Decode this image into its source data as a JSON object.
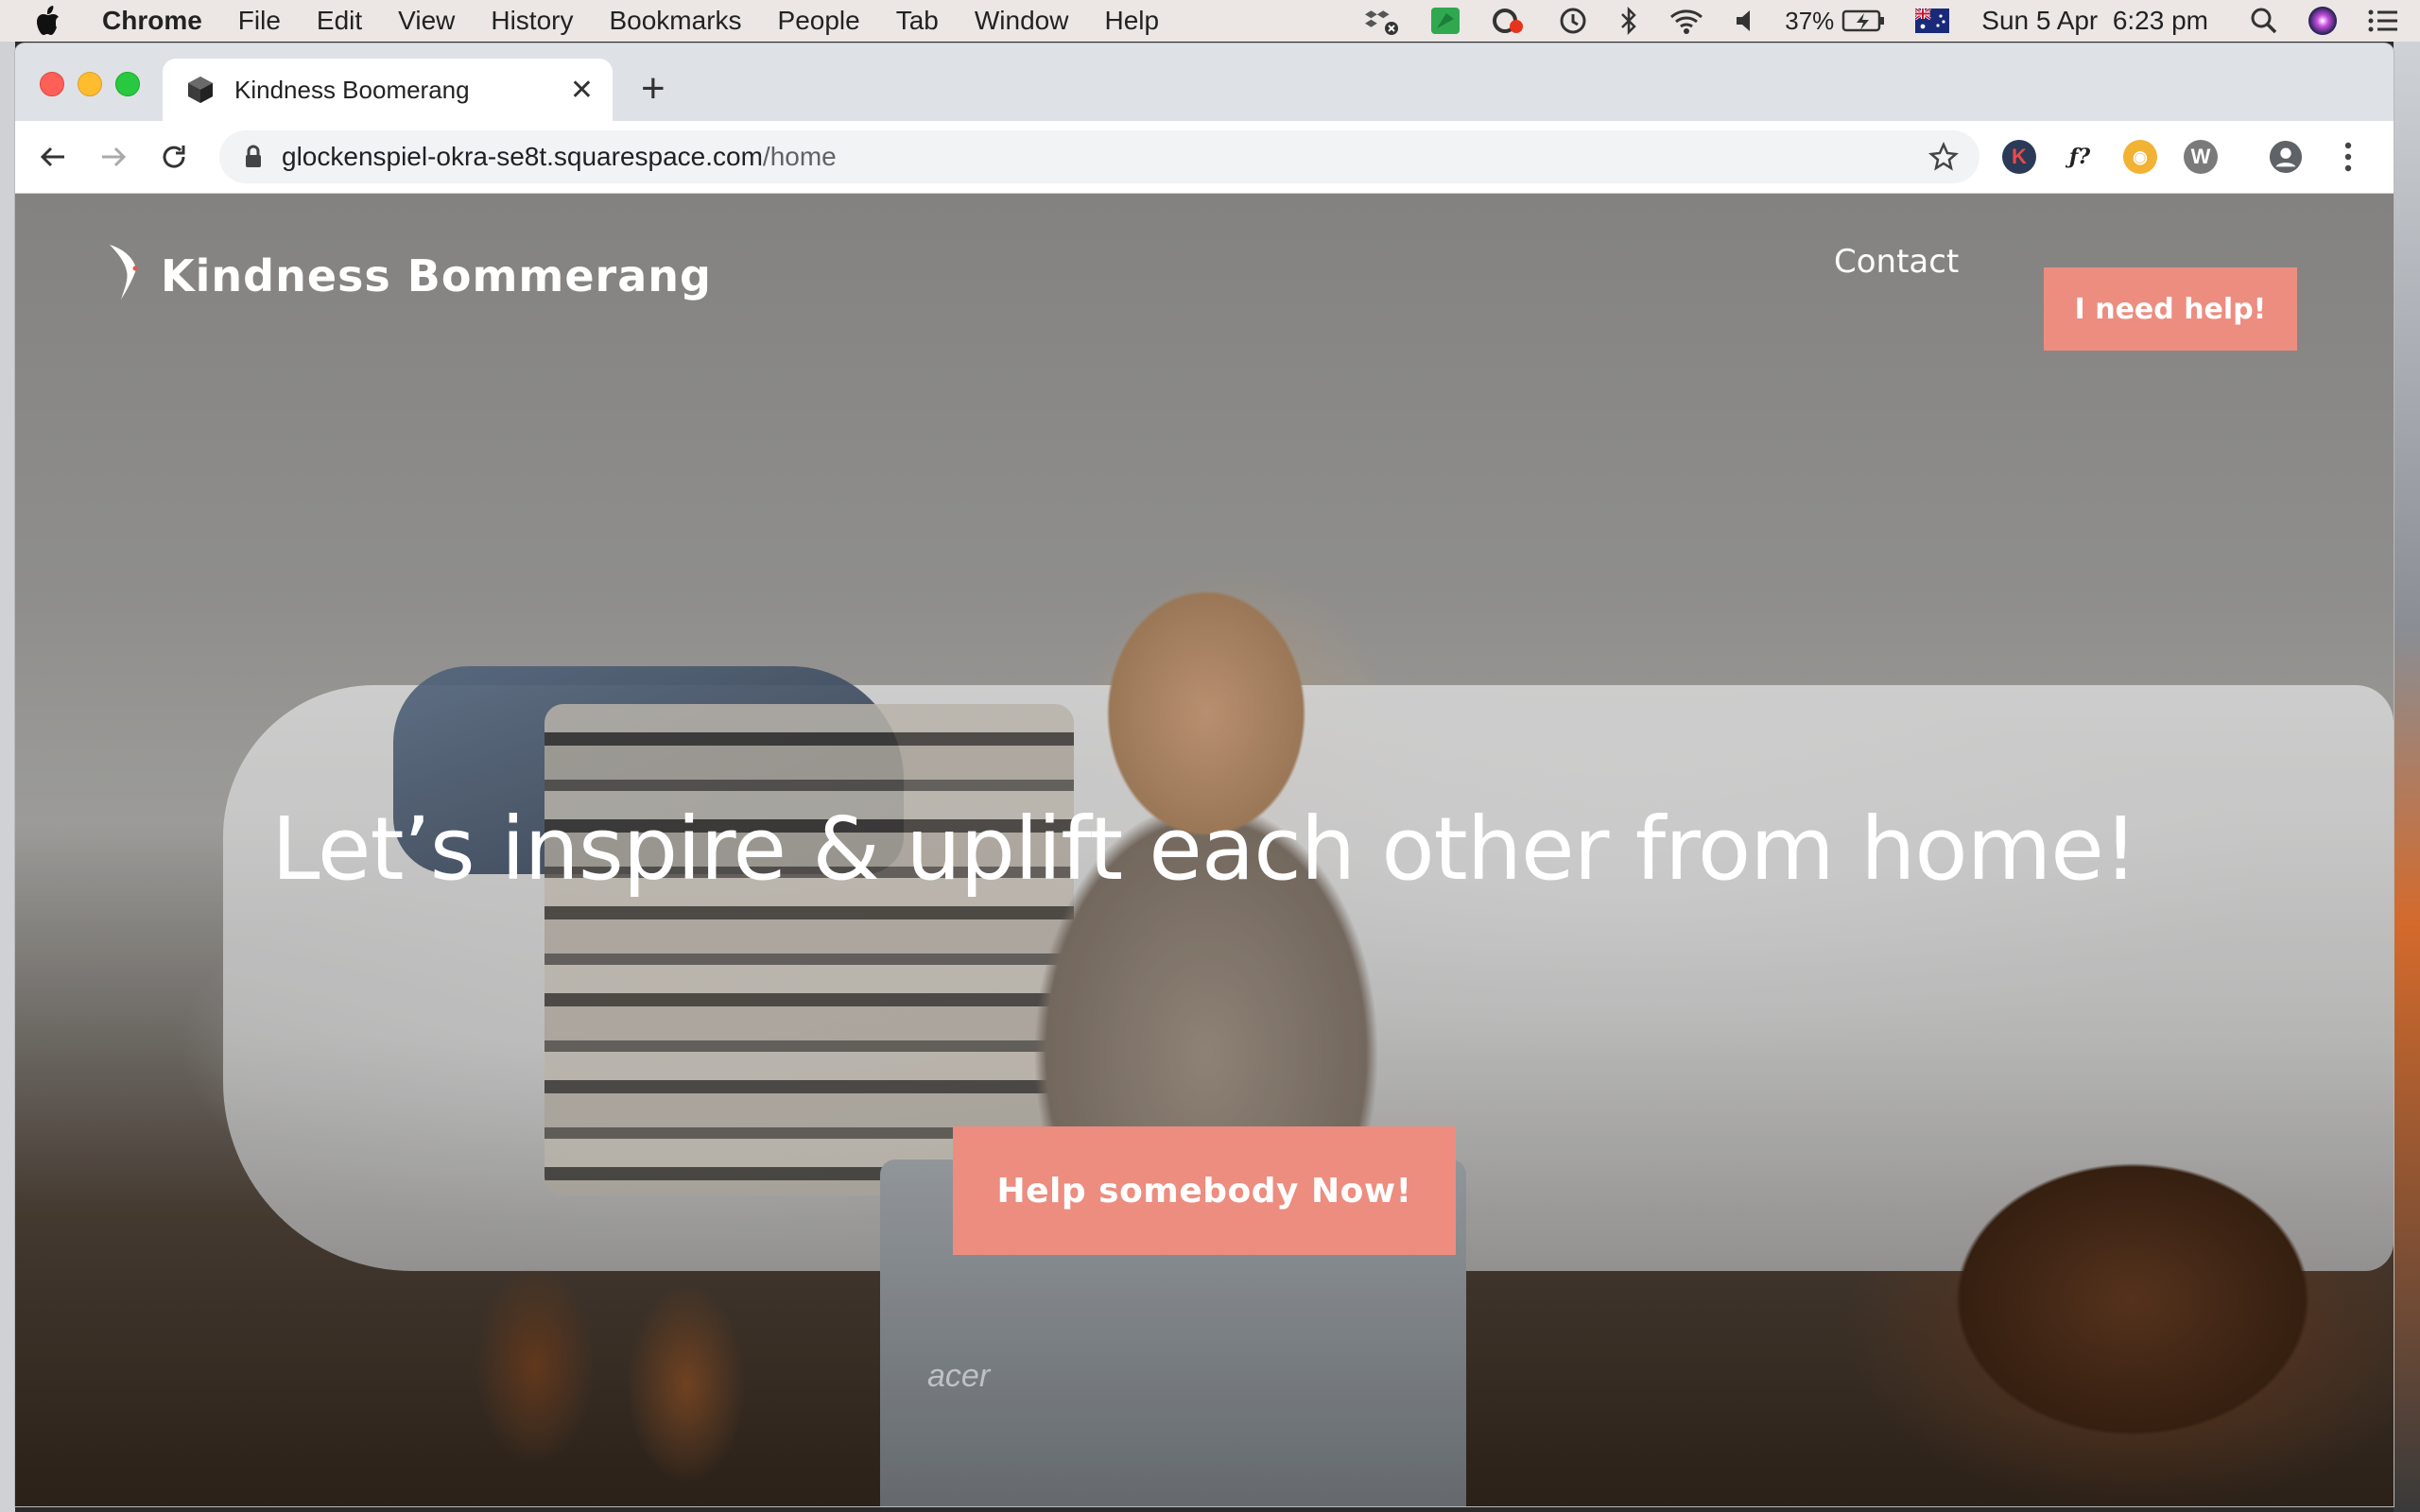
{
  "menubar": {
    "app_name": "Chrome",
    "items": [
      "File",
      "Edit",
      "View",
      "History",
      "Bookmarks",
      "People",
      "Tab",
      "Window",
      "Help"
    ],
    "battery": "37%",
    "datetime": "Sun 5 Apr  6:23 pm"
  },
  "browser": {
    "tab_title": "Kindness Boomerang",
    "url_host": "glockenspiel-okra-se8t.squarespace.com",
    "url_path": "/home",
    "new_tab_symbol": "+",
    "close_symbol": "✕",
    "extensions": [
      {
        "label": "K",
        "color": "#2b3a57"
      },
      {
        "label": "ƒ?",
        "color": "#ffffff"
      },
      {
        "label": "◉",
        "color": "#f2b233"
      },
      {
        "label": "W",
        "color": "#7a7a7a"
      }
    ]
  },
  "site": {
    "logo_text": "Kindness Bommerang",
    "nav_contact": "Contact",
    "help_button": "I need help!",
    "hero_title": "Let’s inspire & uplift each other from home!",
    "cta_button": "Help somebody Now!",
    "laptop_brand": "acer",
    "accent_color": "#ec8d80"
  }
}
